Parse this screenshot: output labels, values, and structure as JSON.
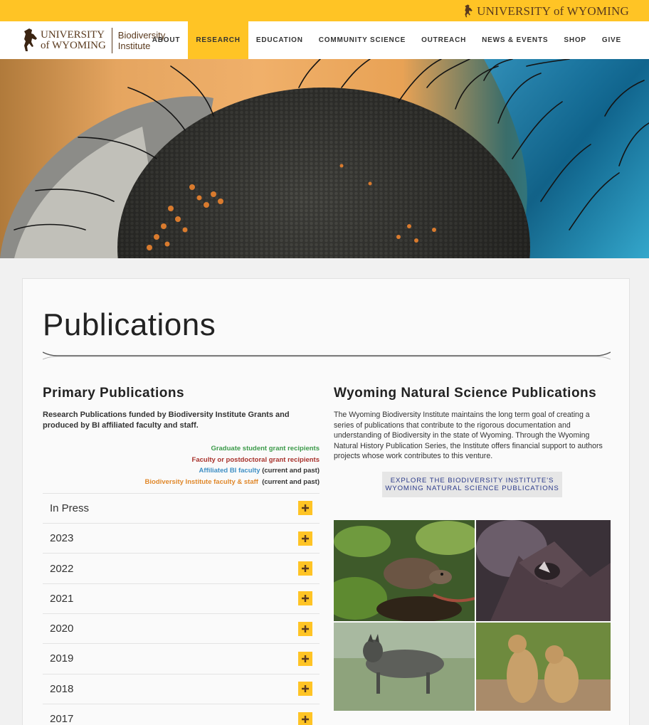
{
  "brand": {
    "topbar_wordmark": "UNIVERSITY of WYOMING",
    "logo_university": "UNIVERSITY",
    "logo_of_wyoming": "of WYOMING",
    "logo_bi_line1": "Biodiversity",
    "logo_bi_line2": "Institute",
    "accent_color": "#ffc425",
    "brown_color": "#5a3a1e"
  },
  "nav": {
    "items": [
      {
        "label": "ABOUT",
        "active": false
      },
      {
        "label": "RESEARCH",
        "active": true
      },
      {
        "label": "EDUCATION",
        "active": false
      },
      {
        "label": "COMMUNITY SCIENCE",
        "active": false
      },
      {
        "label": "OUTREACH",
        "active": false
      },
      {
        "label": "NEWS & EVENTS",
        "active": false
      },
      {
        "label": "SHOP",
        "active": false
      },
      {
        "label": "GIVE",
        "active": false
      }
    ]
  },
  "page": {
    "title": "Publications"
  },
  "primary": {
    "heading": "Primary Publications",
    "description": "Research Publications funded by Biodiversity Institute Grants and produced by BI affiliated faculty and staff.",
    "legend": [
      {
        "label": "Graduate student grant recipients",
        "suffix": "",
        "color": "#3c9a4a"
      },
      {
        "label": "Faculty or postdoctoral grant recipients",
        "suffix": "",
        "color": "#a8322c"
      },
      {
        "label": "Affiliated BI faculty",
        "suffix": " (current and past)",
        "color": "#3f8fc4"
      },
      {
        "label": "Biodiversity Institute faculty & staff",
        "suffix": "  (current and past)",
        "color": "#e0882b"
      }
    ],
    "accordion": [
      {
        "label": "In Press"
      },
      {
        "label": "2023"
      },
      {
        "label": "2022"
      },
      {
        "label": "2021"
      },
      {
        "label": "2020"
      },
      {
        "label": "2019"
      },
      {
        "label": "2018"
      },
      {
        "label": "2017"
      }
    ]
  },
  "wyoming": {
    "heading": "Wyoming Natural Science Publications",
    "description": "The Wyoming Biodiversity Institute maintains the long term goal of creating a series of publications that contribute to the rigorous documentation and understanding of Biodiversity in the state of Wyoming. Through the Wyoming Natural History Publication Series, the Institute offers financial support to authors projects whose work contributes to this venture.",
    "button_line1": "EXPLORE THE BIODIVERSITY INSTITUTE'S",
    "button_line2": "WYOMING NATURAL SCIENCE PUBLICATIONS",
    "button_link_color": "#2b3a8a"
  }
}
